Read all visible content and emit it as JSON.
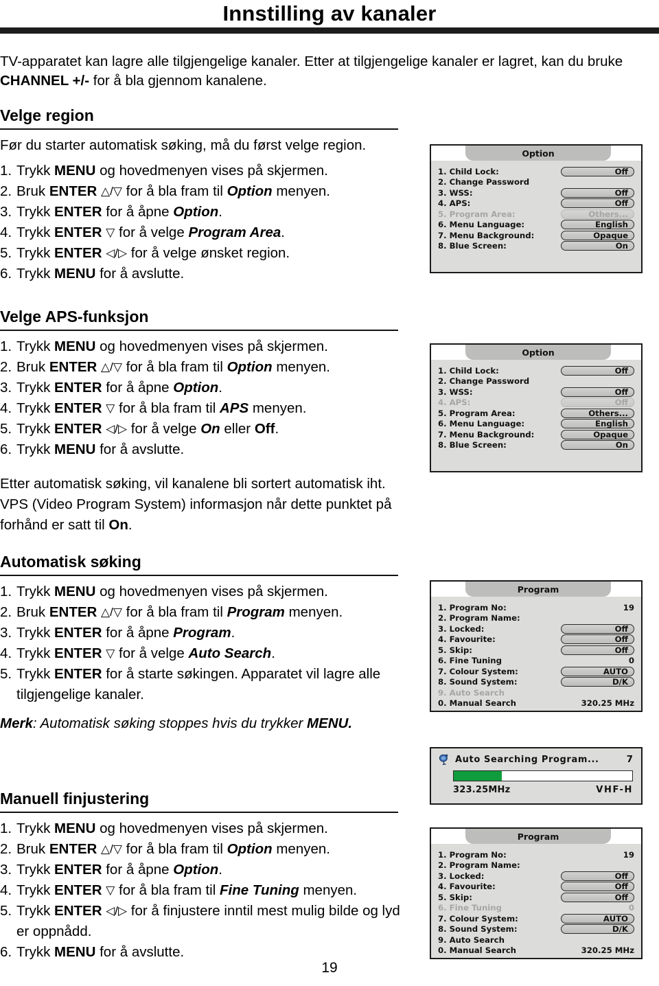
{
  "document": {
    "title": "Innstilling av kanaler",
    "page_number": "19",
    "intro": {
      "line1_a": "TV-apparatet kan lagre alle tilgjengelige kanaler. Etter at tilgjengelige kanaler er lagret, kan du bruke ",
      "line1_b": "CHANNEL +/-",
      "line1_c": " for å bla gjennom kanalene."
    }
  },
  "sections": {
    "region": {
      "heading": "Velge region",
      "lead": "Før du starter automatisk søking, må du først velge region.",
      "steps": [
        {
          "num": "1.",
          "pre": "Trykk ",
          "key": "MENU",
          "mid": " og hovedmenyen vises på skjermen.",
          "arrows": "",
          "em": "",
          "post": ""
        },
        {
          "num": "2.",
          "pre": "Bruk ",
          "key": "ENTER",
          "arrows": "△/▽",
          "mid": " for å bla fram til ",
          "em": "Option",
          "post": " menyen."
        },
        {
          "num": "3.",
          "pre": "Trykk ",
          "key": "ENTER",
          "arrows": "",
          "mid": " for å åpne ",
          "em": "Option",
          "post": "."
        },
        {
          "num": "4.",
          "pre": "Trykk ",
          "key": "ENTER",
          "arrows": "▽",
          "mid": " for å velge ",
          "em": "Program Area",
          "post": "."
        },
        {
          "num": "5.",
          "pre": "Trykk ",
          "key": "ENTER",
          "arrows": "◁/▷",
          "mid": " for å velge ønsket region.",
          "em": "",
          "post": ""
        },
        {
          "num": "6.",
          "pre": "Trykk ",
          "key": "MENU",
          "arrows": "",
          "mid": " for å avslutte.",
          "em": "",
          "post": ""
        }
      ]
    },
    "aps": {
      "heading": "Velge APS-funksjon",
      "steps": [
        {
          "num": "1.",
          "pre": "Trykk ",
          "key": "MENU",
          "arrows": "",
          "mid": " og hovedmenyen vises på skjermen.",
          "em": "",
          "post": ""
        },
        {
          "num": "2.",
          "pre": "Bruk ",
          "key": "ENTER",
          "arrows": "△/▽",
          "mid": " for å bla fram til ",
          "em": "Option",
          "post": " menyen."
        },
        {
          "num": "3.",
          "pre": "Trykk ",
          "key": "ENTER",
          "arrows": "",
          "mid": " for å åpne ",
          "em": "Option",
          "post": "."
        },
        {
          "num": "4.",
          "pre": "Trykk ",
          "key": "ENTER",
          "arrows": "▽",
          "mid": " for å bla fram til ",
          "em": "APS",
          "post": " menyen."
        },
        {
          "num": "5.",
          "pre": "Trykk ",
          "key": "ENTER",
          "arrows": "◁/▷",
          "mid": " for å velge ",
          "em": "On",
          "post": " eller ",
          "post2": "Off",
          "post3": "."
        },
        {
          "num": "6.",
          "pre": "Trykk ",
          "key": "MENU",
          "arrows": "",
          "mid": " for å avslutte.",
          "em": "",
          "post": ""
        }
      ],
      "note_a": "Etter automatisk søking, vil kanalene bli sortert automatisk iht. VPS (Video Program System) informasjon når dette punktet på forhånd er satt til ",
      "note_b": "On",
      "note_c": "."
    },
    "autosearch": {
      "heading": "Automatisk søking",
      "steps": [
        {
          "num": "1.",
          "pre": "Trykk ",
          "key": "MENU",
          "arrows": "",
          "mid": " og hovedmenyen vises på skjermen.",
          "em": "",
          "post": ""
        },
        {
          "num": "2.",
          "pre": "Bruk ",
          "key": "ENTER",
          "arrows": "△/▽",
          "mid": " for å bla fram til ",
          "em": "Program",
          "post": " menyen."
        },
        {
          "num": "3.",
          "pre": "Trykk ",
          "key": "ENTER",
          "arrows": "",
          "mid": " for å åpne ",
          "em": "Program",
          "post": "."
        },
        {
          "num": "4.",
          "pre": "Trykk ",
          "key": "ENTER",
          "arrows": "▽",
          "mid": " for å velge ",
          "em": "Auto Search",
          "post": "."
        },
        {
          "num": "5.",
          "pre": "Trykk ",
          "key": "ENTER",
          "arrows": "",
          "mid": " for å starte søkingen. Apparatet vil lagre alle tilgjengelige kanaler.",
          "em": "",
          "post": ""
        }
      ],
      "merk_label": "Merk",
      "merk_text": ": Automatisk søking stoppes hvis du trykker ",
      "merk_key": "MENU."
    },
    "manual": {
      "heading": "Manuell finjustering",
      "steps": [
        {
          "num": "1.",
          "pre": "Trykk ",
          "key": "MENU",
          "arrows": "",
          "mid": " og hovedmenyen vises på skjermen.",
          "em": "",
          "post": ""
        },
        {
          "num": "2.",
          "pre": "Bruk ",
          "key": "ENTER",
          "arrows": "△/▽",
          "mid": " for å bla fram til ",
          "em": "Option",
          "post": " menyen."
        },
        {
          "num": "3.",
          "pre": "Trykk ",
          "key": "ENTER",
          "arrows": "",
          "mid": " for å åpne ",
          "em": "Option",
          "post": "."
        },
        {
          "num": "4.",
          "pre": "Trykk ",
          "key": "ENTER",
          "arrows": "▽",
          "mid": " for å bla fram til ",
          "em": "Fine Tuning",
          "post": " menyen."
        },
        {
          "num": "5.",
          "pre": "Trykk ",
          "key": "ENTER",
          "arrows": "◁/▷",
          "mid": " for å finjustere inntil mest mulig bilde og lyd er oppnådd.",
          "em": "",
          "post": ""
        },
        {
          "num": "6.",
          "pre": "Trykk ",
          "key": "MENU",
          "arrows": "",
          "mid": " for å avslutte.",
          "em": "",
          "post": ""
        }
      ]
    }
  },
  "osd_panels": {
    "option_region": {
      "title": "Option",
      "rows": [
        {
          "label": "1. Child Lock:",
          "value": "Off",
          "kind": "button",
          "dim": false
        },
        {
          "label": "2. Change Password",
          "value": "",
          "kind": "none",
          "dim": false
        },
        {
          "label": "3. WSS:",
          "value": "Off",
          "kind": "button",
          "dim": false
        },
        {
          "label": "4. APS:",
          "value": "Off",
          "kind": "button",
          "dim": false
        },
        {
          "label": "5. Program Area:",
          "value": "Others...",
          "kind": "button",
          "dim": true
        },
        {
          "label": "6. Menu Language:",
          "value": "English",
          "kind": "button",
          "dim": false
        },
        {
          "label": "7. Menu Background:",
          "value": "Opaque",
          "kind": "button",
          "dim": false
        },
        {
          "label": "8. Blue Screen:",
          "value": "On",
          "kind": "button",
          "dim": false
        }
      ]
    },
    "option_aps": {
      "title": "Option",
      "rows": [
        {
          "label": "1. Child Lock:",
          "value": "Off",
          "kind": "button",
          "dim": false
        },
        {
          "label": "2. Change Password",
          "value": "",
          "kind": "none",
          "dim": false
        },
        {
          "label": "3. WSS:",
          "value": "Off",
          "kind": "button",
          "dim": false
        },
        {
          "label": "4. APS:",
          "value": "Off",
          "kind": "button",
          "dim": true
        },
        {
          "label": "5. Program Area:",
          "value": "Others...",
          "kind": "button",
          "dim": false
        },
        {
          "label": "6. Menu Language:",
          "value": "English",
          "kind": "button",
          "dim": false
        },
        {
          "label": "7. Menu Background:",
          "value": "Opaque",
          "kind": "button",
          "dim": false
        },
        {
          "label": "8. Blue Screen:",
          "value": "On",
          "kind": "button",
          "dim": false
        }
      ]
    },
    "program_auto": {
      "title": "Program",
      "rows": [
        {
          "label": "1. Program No:",
          "value": "19",
          "kind": "plain",
          "dim": false
        },
        {
          "label": "2. Program Name:",
          "value": "",
          "kind": "none",
          "dim": false
        },
        {
          "label": "3. Locked:",
          "value": "Off",
          "kind": "button",
          "dim": false
        },
        {
          "label": "4. Favourite:",
          "value": "Off",
          "kind": "button",
          "dim": false
        },
        {
          "label": "5. Skip:",
          "value": "Off",
          "kind": "button",
          "dim": false
        },
        {
          "label": "6. Fine Tuning",
          "value": "0",
          "kind": "plain",
          "dim": false
        },
        {
          "label": "7. Colour System:",
          "value": "AUTO",
          "kind": "button",
          "dim": false
        },
        {
          "label": "8. Sound System:",
          "value": "D/K",
          "kind": "button",
          "dim": false
        },
        {
          "label": "9. Auto Search",
          "value": "",
          "kind": "none",
          "dim": true
        },
        {
          "label": "0. Manual Search",
          "value": "320.25 MHz",
          "kind": "plain",
          "dim": false
        }
      ]
    },
    "program_manual": {
      "title": "Program",
      "rows": [
        {
          "label": "1. Program No:",
          "value": "19",
          "kind": "plain",
          "dim": false
        },
        {
          "label": "2. Program Name:",
          "value": "",
          "kind": "none",
          "dim": false
        },
        {
          "label": "3. Locked:",
          "value": "Off",
          "kind": "button",
          "dim": false
        },
        {
          "label": "4. Favourite:",
          "value": "Off",
          "kind": "button",
          "dim": false
        },
        {
          "label": "5. Skip:",
          "value": "Off",
          "kind": "button",
          "dim": false
        },
        {
          "label": "6. Fine Tuning",
          "value": "0",
          "kind": "plain",
          "dim": true
        },
        {
          "label": "7. Colour System:",
          "value": "AUTO",
          "kind": "button",
          "dim": false
        },
        {
          "label": "8. Sound System:",
          "value": "D/K",
          "kind": "button",
          "dim": false
        },
        {
          "label": "9. Auto Search",
          "value": "",
          "kind": "none",
          "dim": false
        },
        {
          "label": "0. Manual Search",
          "value": "320.25 MHz",
          "kind": "plain",
          "dim": false
        }
      ]
    }
  },
  "search_progress": {
    "icon": "satellite-dish-icon",
    "title": "Auto Searching Program...",
    "count": "7",
    "progress_percent": 27,
    "frequency": "323.25MHz",
    "band": "VHF-H",
    "fill_color": "#109c3c"
  }
}
